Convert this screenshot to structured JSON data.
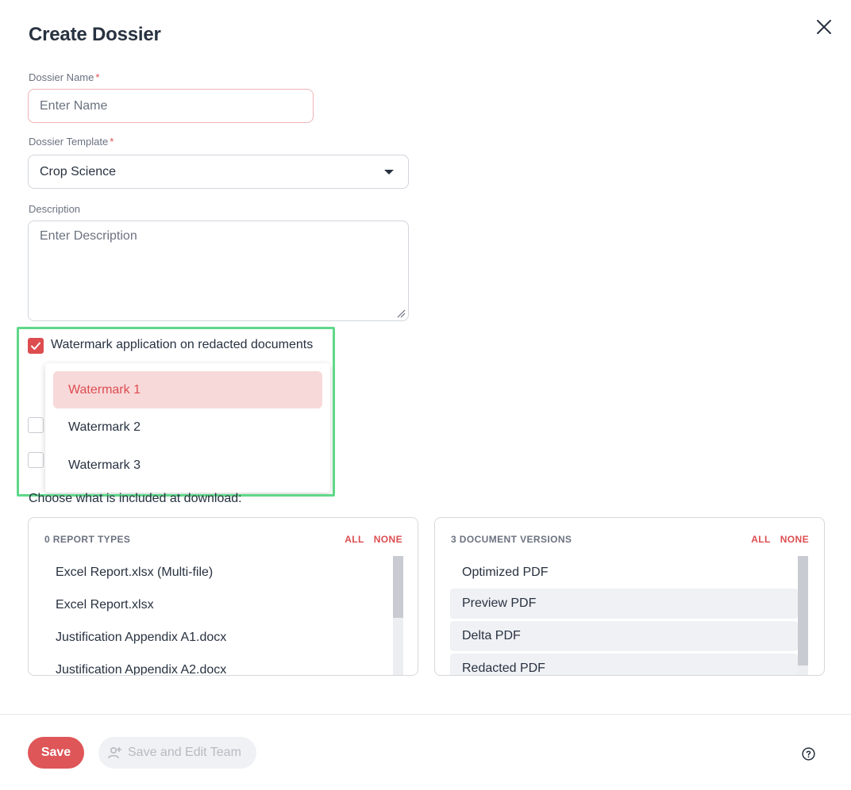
{
  "dialog": {
    "title": "Create Dossier"
  },
  "form": {
    "name_label": "Dossier Name",
    "name_required": "*",
    "name_placeholder": "Enter Name",
    "template_label": "Dossier Template",
    "template_required": "*",
    "template_value": "Crop Science",
    "description_label": "Description",
    "description_placeholder": "Enter Description"
  },
  "watermark": {
    "checkbox_label": "Watermark application on redacted documents",
    "checked": true,
    "options": [
      {
        "label": "Watermark 1",
        "selected": true
      },
      {
        "label": "Watermark 2",
        "selected": false
      },
      {
        "label": "Watermark 3",
        "selected": false
      }
    ]
  },
  "download": {
    "heading": "Choose what is included at download:",
    "report_types": {
      "title": "0 REPORT TYPES",
      "all": "ALL",
      "none": "NONE",
      "items": [
        "Excel Report.xlsx (Multi-file)",
        "Excel Report.xlsx",
        "Justification Appendix A1.docx",
        "Justification Appendix A2.docx"
      ]
    },
    "document_versions": {
      "title": "3 DOCUMENT VERSIONS",
      "all": "ALL",
      "none": "NONE",
      "items": [
        {
          "label": "Optimized PDF",
          "selected": false
        },
        {
          "label": "Preview PDF",
          "selected": true
        },
        {
          "label": "Delta PDF",
          "selected": true
        },
        {
          "label": "Redacted PDF",
          "selected": true
        }
      ]
    }
  },
  "footer": {
    "save_label": "Save",
    "save_edit_team_label": "Save and Edit Team"
  },
  "colors": {
    "accent": "#dd4d50",
    "highlight_border": "#5fd889",
    "selected_option_bg": "#f7d9da"
  }
}
